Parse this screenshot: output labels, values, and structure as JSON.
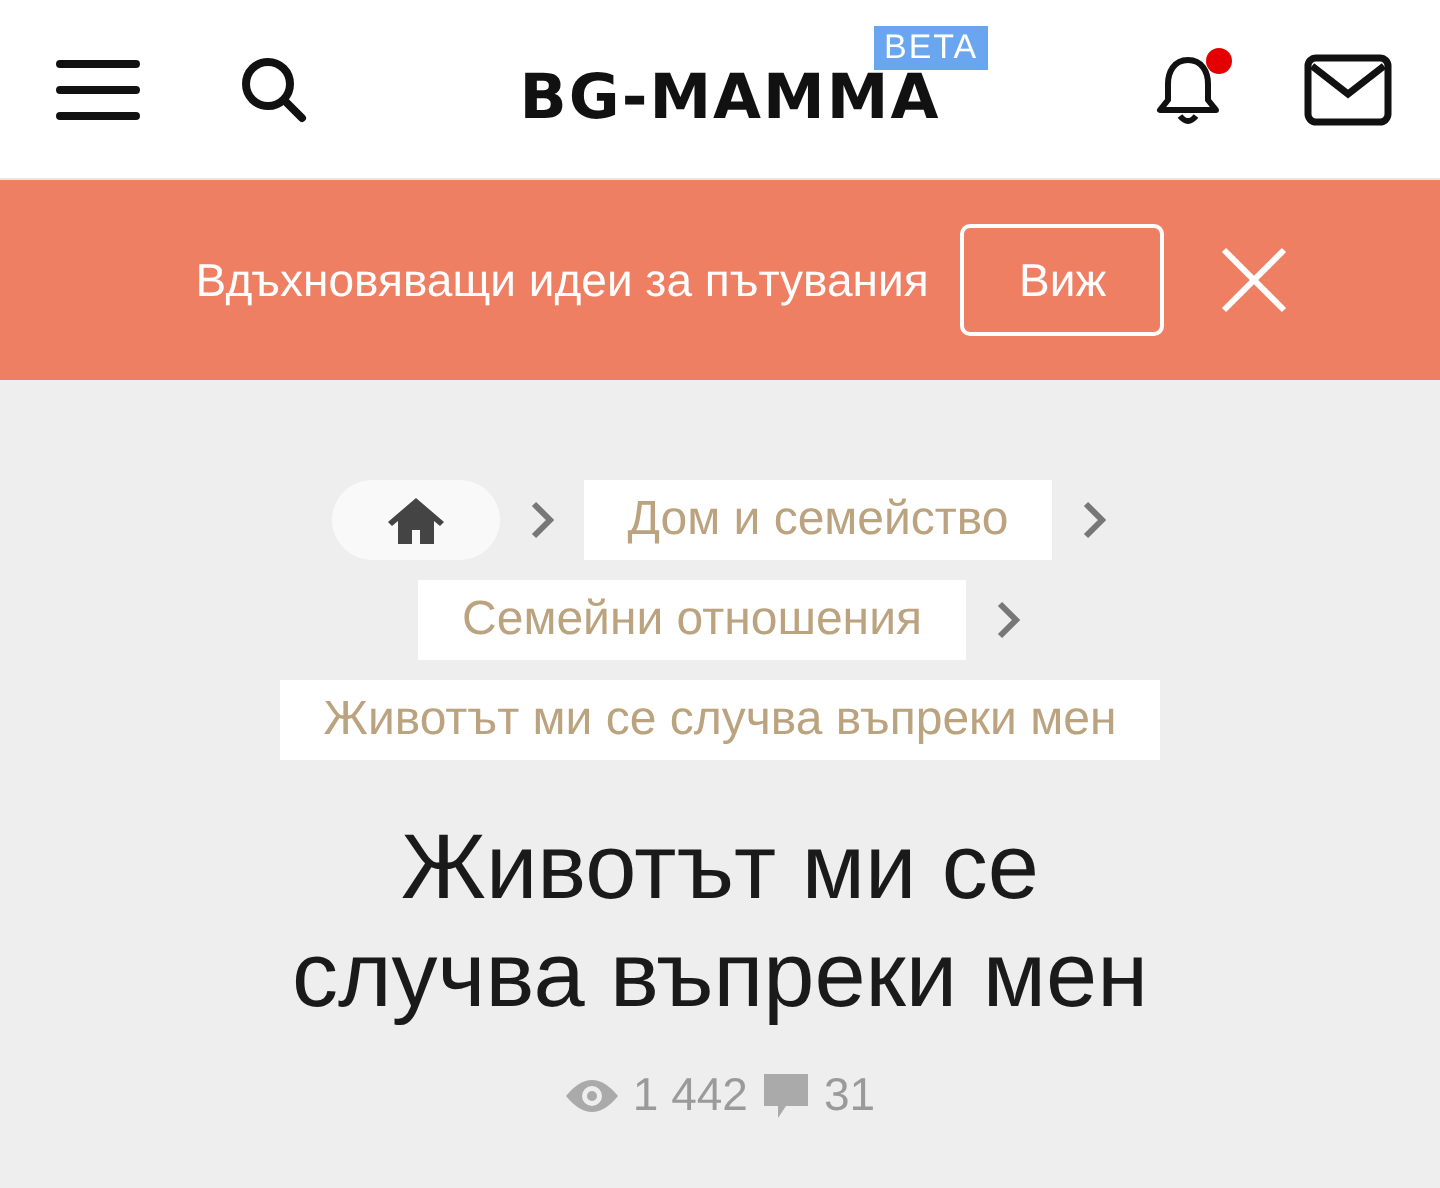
{
  "header": {
    "logo": "BG-MAMMA",
    "badge": "BETA",
    "notifications": {
      "unread": true
    }
  },
  "banner": {
    "text": "Вдъхновяващи идеи за пътувания",
    "button": "Виж"
  },
  "breadcrumbs": [
    {
      "kind": "home"
    },
    {
      "kind": "link",
      "label": "Дом и семейство"
    },
    {
      "kind": "link",
      "label": "Семейни отношения"
    },
    {
      "kind": "link",
      "label": "Животът ми се случва въпреки мен"
    }
  ],
  "title": "Животът ми се случва въпреки мен",
  "stats": {
    "views": "1 442",
    "comments": "31"
  }
}
